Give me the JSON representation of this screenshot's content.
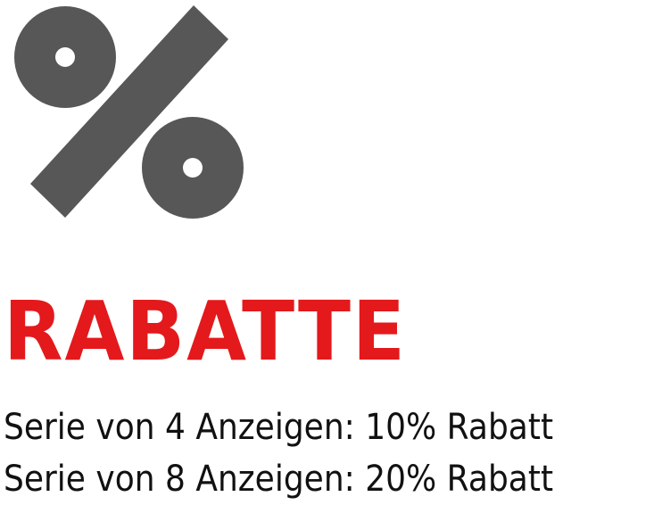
{
  "colors": {
    "icon": "#575757",
    "title": "#e3191c",
    "text": "#111111",
    "background": "#ffffff"
  },
  "icon": {
    "name": "percent-icon"
  },
  "title": "RABATTE",
  "offers": [
    "Serie von 4 Anzeigen: 10% Rabatt",
    "Serie von 8 Anzeigen: 20% Rabatt"
  ]
}
